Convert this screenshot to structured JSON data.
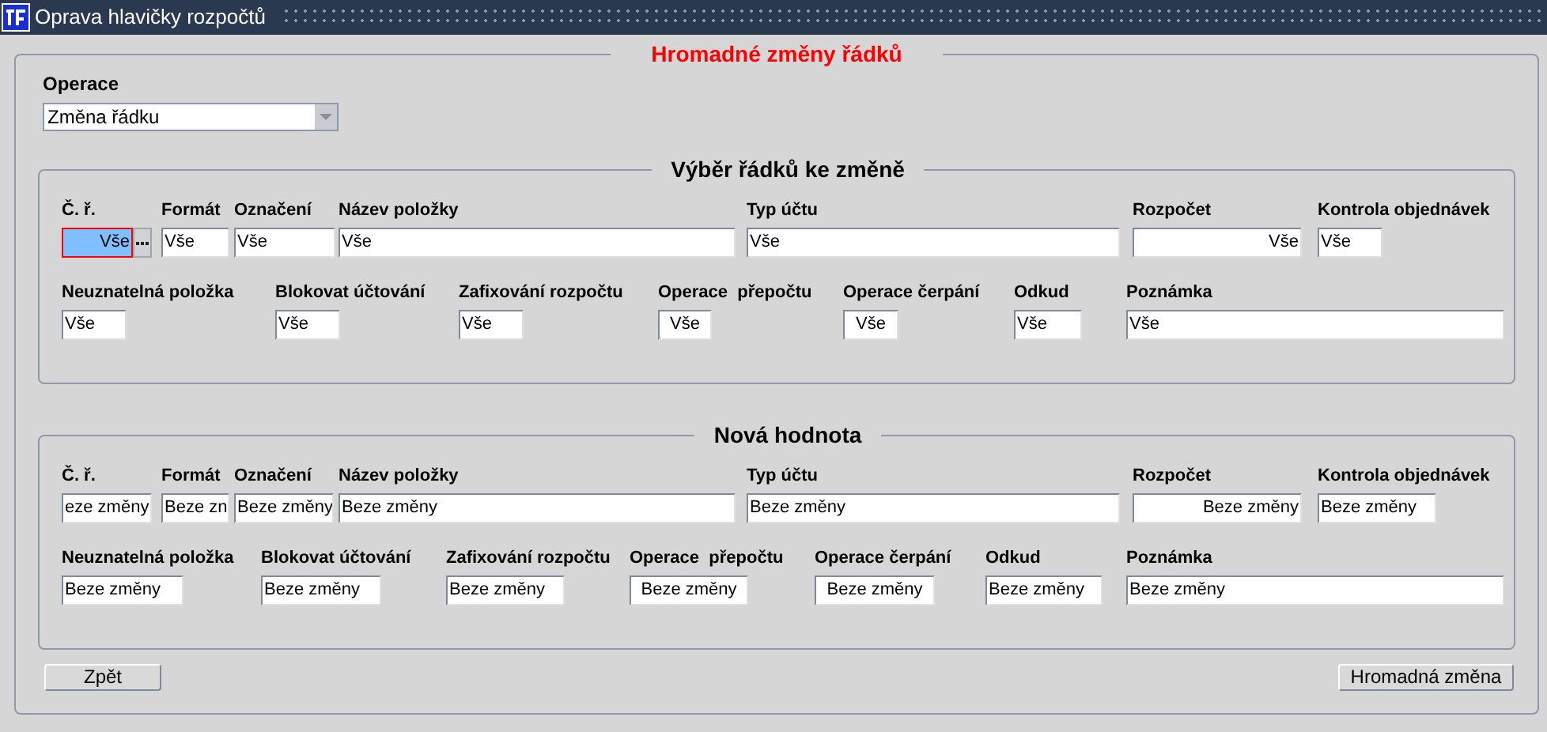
{
  "window": {
    "title": "Oprava hlavičky rozpočtů"
  },
  "form": {
    "title": "Hromadné změny řádků",
    "operation": {
      "label": "Operace",
      "value": "Změna řádku"
    },
    "sections": [
      {
        "title": "Výběr řádků ke změně",
        "rows": [
          {
            "fields": [
              {
                "kind": "lookup",
                "label": "Č. ř.",
                "value": "Vše",
                "focused": true
              },
              {
                "kind": "text",
                "label": "Formát",
                "value": "Vše",
                "focused": false
              },
              {
                "kind": "text",
                "label": "Označení",
                "value": "Vše",
                "focused": false
              },
              {
                "kind": "text",
                "label": "Název položky",
                "value": "Vše",
                "focused": false
              },
              {
                "kind": "text",
                "label": "Typ účtu",
                "value": "Vše",
                "focused": false
              },
              {
                "kind": "text",
                "label": "Rozpočet",
                "value": "Vše",
                "focused": false
              },
              {
                "kind": "text",
                "label": "Kontrola objednávek",
                "value": "Vše",
                "focused": false
              }
            ]
          },
          {
            "fields": [
              {
                "kind": "text",
                "label": "Neuznatelná položka",
                "value": "Vše",
                "focused": false
              },
              {
                "kind": "text",
                "label": "Blokovat účtování",
                "value": "Vše",
                "focused": false
              },
              {
                "kind": "text",
                "label": "Zafixování rozpočtu",
                "value": "Vše",
                "focused": false
              },
              {
                "kind": "text",
                "label": "Operace  přepočtu",
                "value": "Vše",
                "focused": false
              },
              {
                "kind": "text",
                "label": "Operace čerpání",
                "value": "Vše",
                "focused": false
              },
              {
                "kind": "text",
                "label": "Odkud",
                "value": "Vše",
                "focused": false
              },
              {
                "kind": "text",
                "label": "Poznámka",
                "value": "Vše",
                "focused": false
              }
            ]
          }
        ]
      },
      {
        "title": "Nová hodnota",
        "rows": [
          {
            "fields": [
              {
                "kind": "text",
                "label": "Č. ř.",
                "value": "eze změny",
                "focused": false
              },
              {
                "kind": "text",
                "label": "Formát",
                "value": "Beze zn",
                "focused": false
              },
              {
                "kind": "text",
                "label": "Označení",
                "value": "Beze změny",
                "focused": false
              },
              {
                "kind": "text",
                "label": "Název položky",
                "value": "Beze změny",
                "focused": false
              },
              {
                "kind": "text",
                "label": "Typ účtu",
                "value": "Beze změny",
                "focused": false
              },
              {
                "kind": "text",
                "label": "Rozpočet",
                "value": "Beze změny",
                "focused": false
              },
              {
                "kind": "text",
                "label": "Kontrola objednávek",
                "value": "Beze změny",
                "focused": false
              }
            ]
          },
          {
            "fields": [
              {
                "kind": "text",
                "label": "Neuznatelná položka",
                "value": "Beze změny",
                "focused": false
              },
              {
                "kind": "text",
                "label": "Blokovat účtování",
                "value": "Beze změny",
                "focused": false
              },
              {
                "kind": "text",
                "label": "Zafixování rozpočtu",
                "value": "Beze změny",
                "focused": false
              },
              {
                "kind": "text",
                "label": "Operace  přepočtu",
                "value": "Beze změny",
                "focused": false
              },
              {
                "kind": "text",
                "label": "Operace čerpání",
                "value": "Beze změny",
                "focused": false
              },
              {
                "kind": "text",
                "label": "Odkud",
                "value": "Beze změny",
                "focused": false
              },
              {
                "kind": "text",
                "label": "Poznámka",
                "value": "Beze změny",
                "focused": false
              }
            ]
          }
        ]
      }
    ],
    "buttons": [
      "Zpět",
      "Hromadná změna"
    ]
  }
}
